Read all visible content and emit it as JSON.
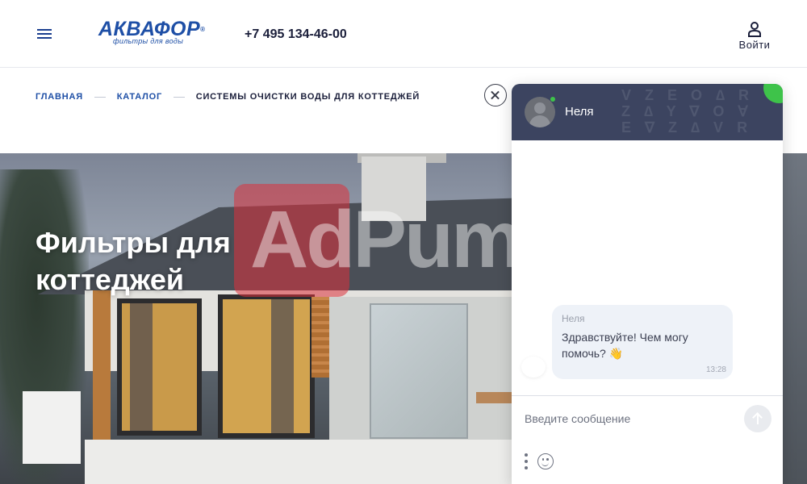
{
  "header": {
    "logo_text": "АКВАФОР",
    "logo_reg": "®",
    "logo_tagline": "фильтры для воды",
    "phone": "+7 495 134-46-00",
    "login_label": "Войти"
  },
  "breadcrumb": {
    "items": [
      "ГЛАВНАЯ",
      "КАТАЛОГ"
    ],
    "current": "СИСТЕМЫ ОЧИСТКИ ВОДЫ ДЛЯ КОТТЕДЖЕЙ"
  },
  "hero": {
    "title": "Фильтры для коттеджей"
  },
  "watermark": {
    "text": "AdPump"
  },
  "chat": {
    "operator_name": "Неля",
    "online": true,
    "message": {
      "author": "Неля",
      "text": "Здравствуйте! Чем могу помочь? 👋",
      "time": "13:28"
    },
    "input_placeholder": "Введите сообщение"
  },
  "colors": {
    "brand": "#1e4fa6",
    "chat_header": "#3c4460",
    "online": "#3ec34a"
  }
}
